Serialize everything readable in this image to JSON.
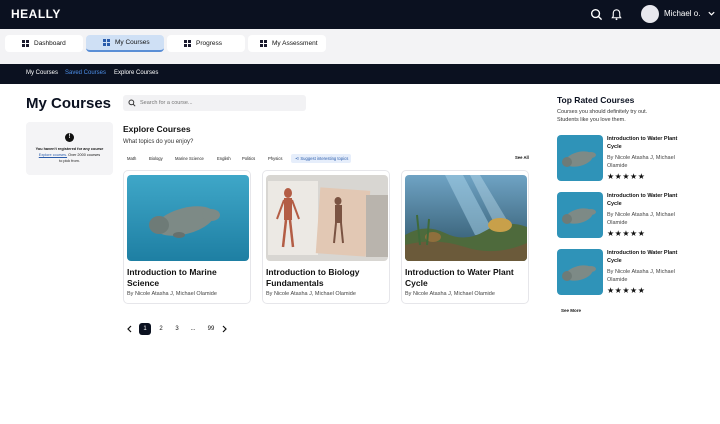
{
  "app": {
    "logo": "HEALLY",
    "user_name": "Michael o."
  },
  "tabs": [
    {
      "label": "Dashboard"
    },
    {
      "label": "My Courses"
    },
    {
      "label": "Progress"
    },
    {
      "label": "My Assessment"
    }
  ],
  "subnav": [
    {
      "label": "My Courses"
    },
    {
      "label": "Saved Courses"
    },
    {
      "label": "Explore Courses"
    }
  ],
  "page_title": "My Courses",
  "search": {
    "placeholder": "Search for a course..."
  },
  "notice": {
    "line1": "You haven't registered for any course",
    "link": "Explore courses.",
    "line2": " Over 2000 courses",
    "line3": "to pick from."
  },
  "explore": {
    "title": "Explore Courses",
    "subtitle": "What topics do you enjoy?",
    "see_all": "See All",
    "topics": [
      "Math",
      "Biology",
      "Marine Science",
      "English",
      "Politics",
      "Physics"
    ],
    "suggest": "Suggest interesting topics"
  },
  "courses": [
    {
      "title": "Introduction to Marine Science",
      "authors": "By Nicole Atasha J, Michael Olamide"
    },
    {
      "title": "Introduction to Biology Fundamentals",
      "authors": "By Nicole Atasha J, Michael Olamide"
    },
    {
      "title": "Introduction to Water Plant Cycle",
      "authors": "By Nicole Atasha J, Michael Olamide"
    }
  ],
  "pagination": {
    "pages": [
      "1",
      "2",
      "3",
      "...",
      "99"
    ],
    "current": "1"
  },
  "top_rated": {
    "title": "Top Rated Courses",
    "subtitle": "Courses you should definitely try out. Students like you love them.",
    "see_more": "See More",
    "items": [
      {
        "title": "Introduction to Water Plant Cycle",
        "authors": "By Nicole Atasha J, Michael Olamide",
        "stars": "★★★★★",
        "rating": 5
      },
      {
        "title": "Introduction to Water Plant Cycle",
        "authors": "By Nicole Atasha J, Michael Olamide",
        "stars": "★★★★★",
        "rating": 5
      },
      {
        "title": "Introduction to Water Plant Cycle",
        "authors": "By Nicole Atasha J, Michael Olamide",
        "stars": "★★★★★",
        "rating": 5
      }
    ]
  },
  "colors": {
    "nav_bg": "#0b1120",
    "accent": "#4d8fe8",
    "active_tab": "#cfe0f5"
  }
}
